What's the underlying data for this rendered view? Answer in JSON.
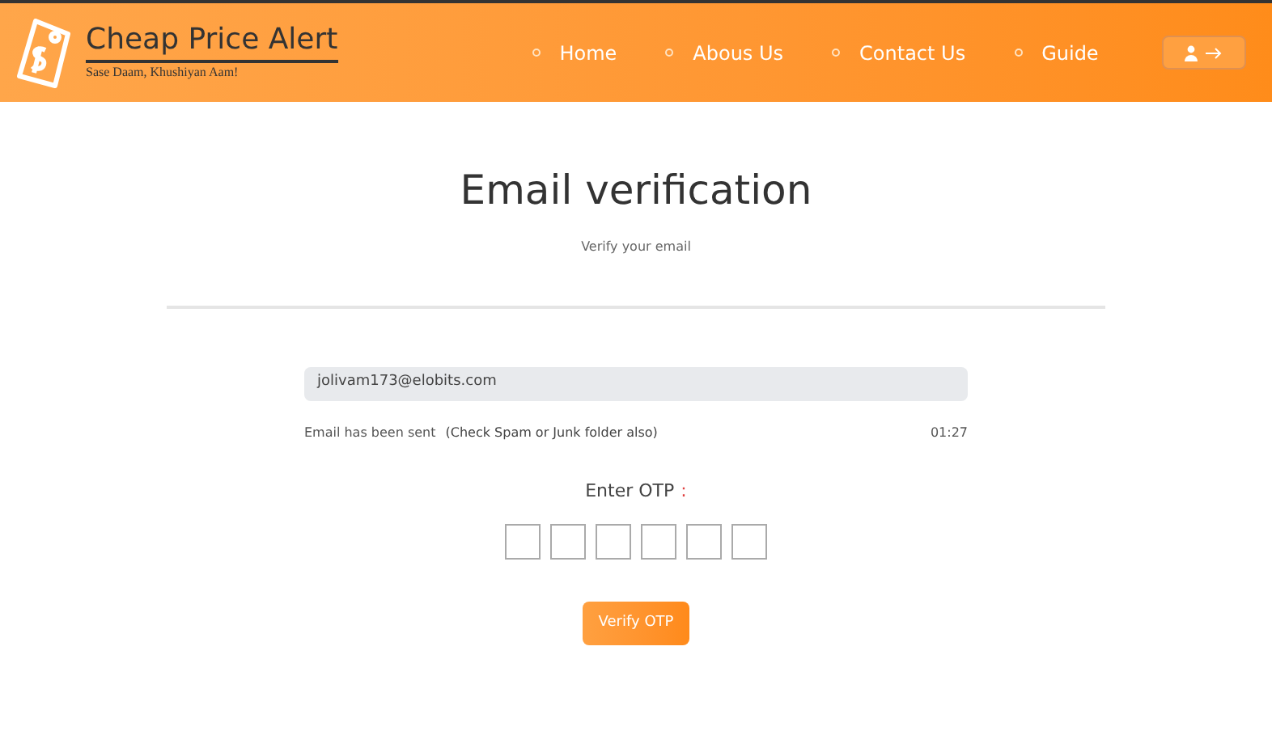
{
  "brand": {
    "name": "Cheap Price Alert",
    "tagline": "Sase Daam, Khushiyan Aam!"
  },
  "nav": [
    {
      "label": "Home"
    },
    {
      "label": "Abous Us"
    },
    {
      "label": "Contact Us"
    },
    {
      "label": "Guide"
    }
  ],
  "page": {
    "title": "Email verification",
    "subtitle": "Verify your email"
  },
  "email": {
    "value": "jolivam173@elobits.com",
    "status": "Email has been sent",
    "hint": "(Check Spam or Junk folder also)",
    "timer": "01:27"
  },
  "otp": {
    "label": "Enter OTP",
    "mark": ":",
    "boxes": [
      {
        "kind": "digit"
      },
      {
        "kind": "digit"
      },
      {
        "kind": "digit"
      },
      {
        "kind": "digit"
      },
      {
        "kind": "digit"
      },
      {
        "kind": "digit"
      }
    ]
  },
  "button": "Verify OTP"
}
